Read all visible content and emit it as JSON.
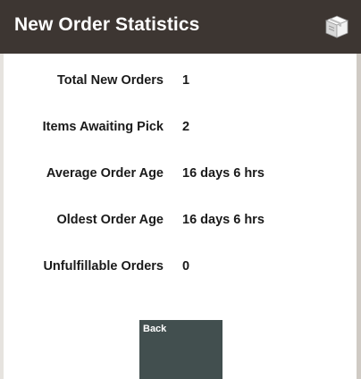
{
  "header": {
    "title": "New Order Statistics",
    "icon": "package-box-icon"
  },
  "stats": [
    {
      "label": "Total New Orders",
      "value": "1"
    },
    {
      "label": "Items Awaiting Pick",
      "value": "2"
    },
    {
      "label": "Average Order Age",
      "value": "16 days 6 hrs"
    },
    {
      "label": "Oldest Order Age",
      "value": "16 days 6 hrs"
    },
    {
      "label": "Unfulfillable Orders",
      "value": "0"
    }
  ],
  "actions": {
    "back_label": "Back"
  },
  "colors": {
    "header_bg": "#3d3632",
    "button_bg": "#424f4f",
    "text": "#1a1a1a"
  }
}
